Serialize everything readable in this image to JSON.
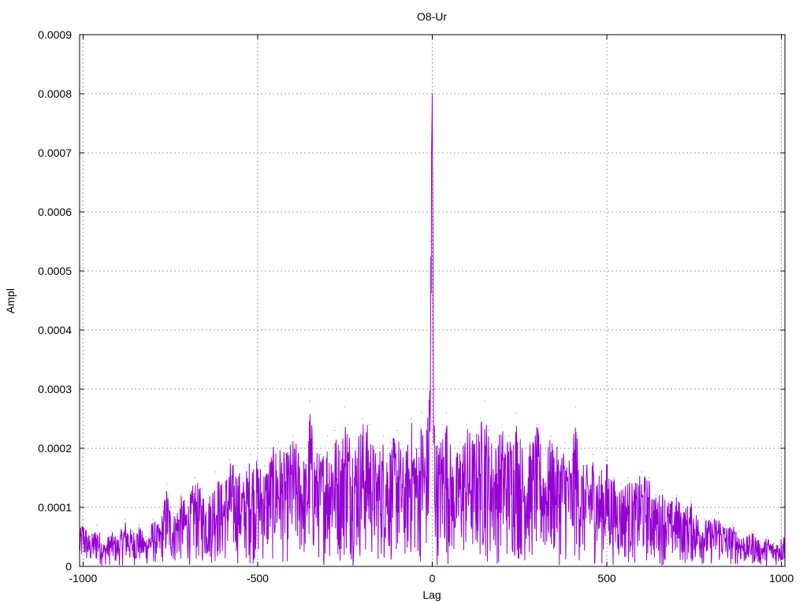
{
  "chart_data": {
    "type": "line",
    "title": "O8-Ur",
    "xlabel": "Lag",
    "ylabel": "Ampl",
    "xlim": [
      -1010,
      1010
    ],
    "ylim": [
      0,
      0.0009
    ],
    "x_ticks": [
      -1000,
      -500,
      0,
      500,
      1000
    ],
    "x_tick_labels": [
      "-1000",
      "-500",
      "0",
      "500",
      "1000"
    ],
    "y_ticks": [
      0,
      0.0001,
      0.0002,
      0.0003,
      0.0004,
      0.0005,
      0.0006,
      0.0007,
      0.0008,
      0.0009
    ],
    "y_tick_labels": [
      "0",
      "0.0001",
      "0.0002",
      "0.0003",
      "0.0004",
      "0.0005",
      "0.0006",
      "0.0007",
      "0.0008",
      "0.0009"
    ],
    "grid": true,
    "line_color": "#9400d3",
    "series": [
      {
        "x": [
          -1010,
          -1000,
          -980,
          -960,
          -940,
          -920,
          -900,
          -880,
          -860,
          -840,
          -820,
          -800,
          -780,
          -760,
          -750,
          -740,
          -720,
          -700,
          -680,
          -660,
          -640,
          -620,
          -600,
          -580,
          -560,
          -540,
          -520,
          -500,
          -480,
          -460,
          -440,
          -420,
          -400,
          -380,
          -360,
          -350,
          -340,
          -320,
          -300,
          -280,
          -260,
          -250,
          -240,
          -220,
          -200,
          -180,
          -160,
          -140,
          -120,
          -100,
          -80,
          -60,
          -40,
          -30,
          -20,
          -10,
          -5,
          0,
          3,
          5,
          10,
          20,
          30,
          40,
          60,
          80,
          100,
          120,
          140,
          150,
          160,
          180,
          200,
          220,
          240,
          260,
          280,
          300,
          320,
          340,
          360,
          380,
          400,
          410,
          420,
          440,
          460,
          480,
          500,
          520,
          540,
          560,
          580,
          600,
          620,
          640,
          660,
          680,
          700,
          720,
          740,
          760,
          780,
          800,
          820,
          840,
          860,
          880,
          900,
          920,
          940,
          960,
          980,
          1000,
          1010
        ],
        "y": [
          6e-05,
          8e-05,
          5e-05,
          7e-05,
          4e-05,
          6e-05,
          5e-05,
          8e-05,
          6e-05,
          7e-05,
          5e-05,
          8e-05,
          7e-05,
          0.00014,
          0.0001,
          9e-05,
          0.00012,
          0.00011,
          0.00015,
          0.00013,
          0.00012,
          0.00016,
          0.00014,
          0.00018,
          0.00017,
          0.00015,
          0.00019,
          0.00018,
          0.00017,
          0.0002,
          0.00021,
          0.00019,
          0.00022,
          0.0002,
          0.00018,
          0.00028,
          0.00021,
          0.00019,
          0.00022,
          0.00023,
          0.00021,
          0.00027,
          0.00024,
          0.00022,
          0.00025,
          0.00024,
          0.00019,
          0.00022,
          0.00021,
          0.00023,
          0.00018,
          0.00025,
          0.0002,
          0.00026,
          0.00022,
          0.00028,
          0.00055,
          0.0008,
          0.00044,
          0.0003,
          0.00022,
          0.00021,
          0.00024,
          0.00026,
          0.00018,
          0.00021,
          0.00024,
          0.00022,
          0.00025,
          0.00028,
          0.00023,
          0.00021,
          0.00024,
          0.00022,
          0.00026,
          0.0002,
          0.00021,
          0.00024,
          0.00019,
          0.00022,
          0.0002,
          0.00021,
          0.00018,
          0.00027,
          0.00018,
          0.00017,
          0.00019,
          0.00016,
          0.00018,
          0.00015,
          0.00014,
          0.00015,
          0.00014,
          0.00016,
          0.00015,
          0.00012,
          0.00013,
          0.00011,
          0.00012,
          0.0001,
          0.00011,
          9e-05,
          8e-05,
          8e-05,
          9e-05,
          7e-05,
          7e-05,
          6e-05,
          5e-05,
          6e-05,
          4e-05,
          5e-05,
          4e-05,
          5e-05,
          6e-05
        ]
      }
    ]
  }
}
